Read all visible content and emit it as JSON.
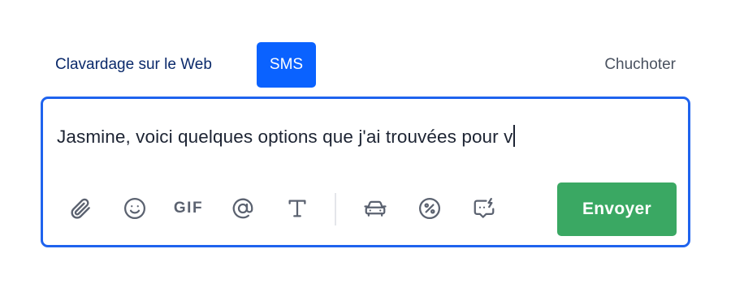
{
  "tabs": {
    "web_chat": "Clavardage sur le Web",
    "sms": "SMS",
    "whisper": "Chuchoter",
    "active": "SMS"
  },
  "composer": {
    "text": "Jasmine, voici quelques options que j'ai trouvées pour v"
  },
  "toolbar": {
    "icons": [
      "paperclip-icon",
      "smiley-icon",
      "gif-icon",
      "at-sign-icon",
      "text-format-icon",
      "car-icon",
      "percent-badge-icon",
      "quick-reply-icon"
    ],
    "gif_label": "GIF",
    "send_label": "Envoyer"
  },
  "colors": {
    "accent": "#0a62ff",
    "border": "#1f63ee",
    "send": "#3aa863",
    "icon": "#5b6270"
  }
}
